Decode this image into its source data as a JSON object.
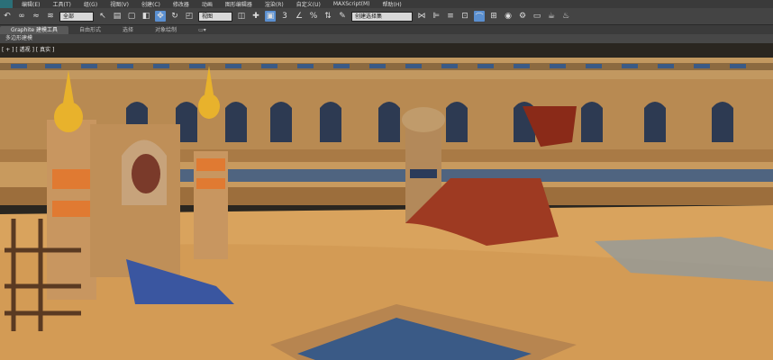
{
  "menu": {
    "items": [
      "编辑(E)",
      "工具(T)",
      "组(G)",
      "视图(V)",
      "创建(C)",
      "修改器",
      "动画",
      "图形编辑器",
      "渲染(R)",
      "自定义(U)",
      "MAXScript(M)",
      "帮助(H)"
    ]
  },
  "toolbar": {
    "selection_filter": "全部",
    "coord_system": "视图",
    "named_selection": "创建选择集"
  },
  "ribbon": {
    "tabs": [
      "Graphite 建模工具",
      "自由形式",
      "选择",
      "对象绘制"
    ],
    "sub_label": "多边形建模"
  },
  "viewport": {
    "label": "[ + ] [ 透视 ] [ 真实 ]"
  },
  "colors": {
    "sand": "#d9a35d",
    "wall_tan": "#c99a5c",
    "blue_trim": "#3a5a86",
    "red_cloth": "#9e3a22",
    "active_tool": "#5a8fd0"
  }
}
